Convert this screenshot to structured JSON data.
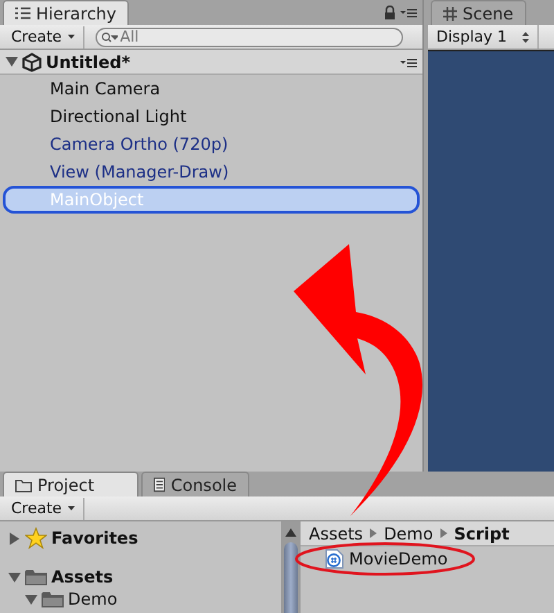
{
  "hierarchy": {
    "tab": "Hierarchy",
    "create": "Create",
    "search": {
      "placeholder": "All"
    },
    "scene": {
      "name": "Untitled*",
      "expanded": true
    },
    "items": [
      {
        "label": "Main Camera",
        "kind": "object",
        "selected": false
      },
      {
        "label": "Directional Light",
        "kind": "object",
        "selected": false
      },
      {
        "label": "Camera Ortho (720p)",
        "kind": "prefab",
        "selected": false
      },
      {
        "label": "View (Manager-Draw)",
        "kind": "prefab",
        "selected": false
      },
      {
        "label": "MainObject",
        "kind": "object",
        "selected": true
      }
    ]
  },
  "scene_view": {
    "tab": "Scene",
    "display": "Display 1"
  },
  "bottom_tabs": [
    {
      "label": "Project",
      "kind": "project",
      "selected": true
    },
    {
      "label": "Console",
      "kind": "console",
      "selected": false
    }
  ],
  "project": {
    "create": "Create",
    "tree": [
      {
        "label": "Favorites",
        "kind": "favorites",
        "expanded": false
      },
      {
        "label": "Assets",
        "kind": "folder",
        "expanded": true,
        "children": [
          {
            "label": "Demo",
            "kind": "folder",
            "expanded": true
          }
        ]
      }
    ],
    "breadcrumb": [
      "Assets",
      "Demo",
      "Script"
    ],
    "files": [
      {
        "name": "MovieDemo",
        "kind": "script"
      }
    ]
  }
}
